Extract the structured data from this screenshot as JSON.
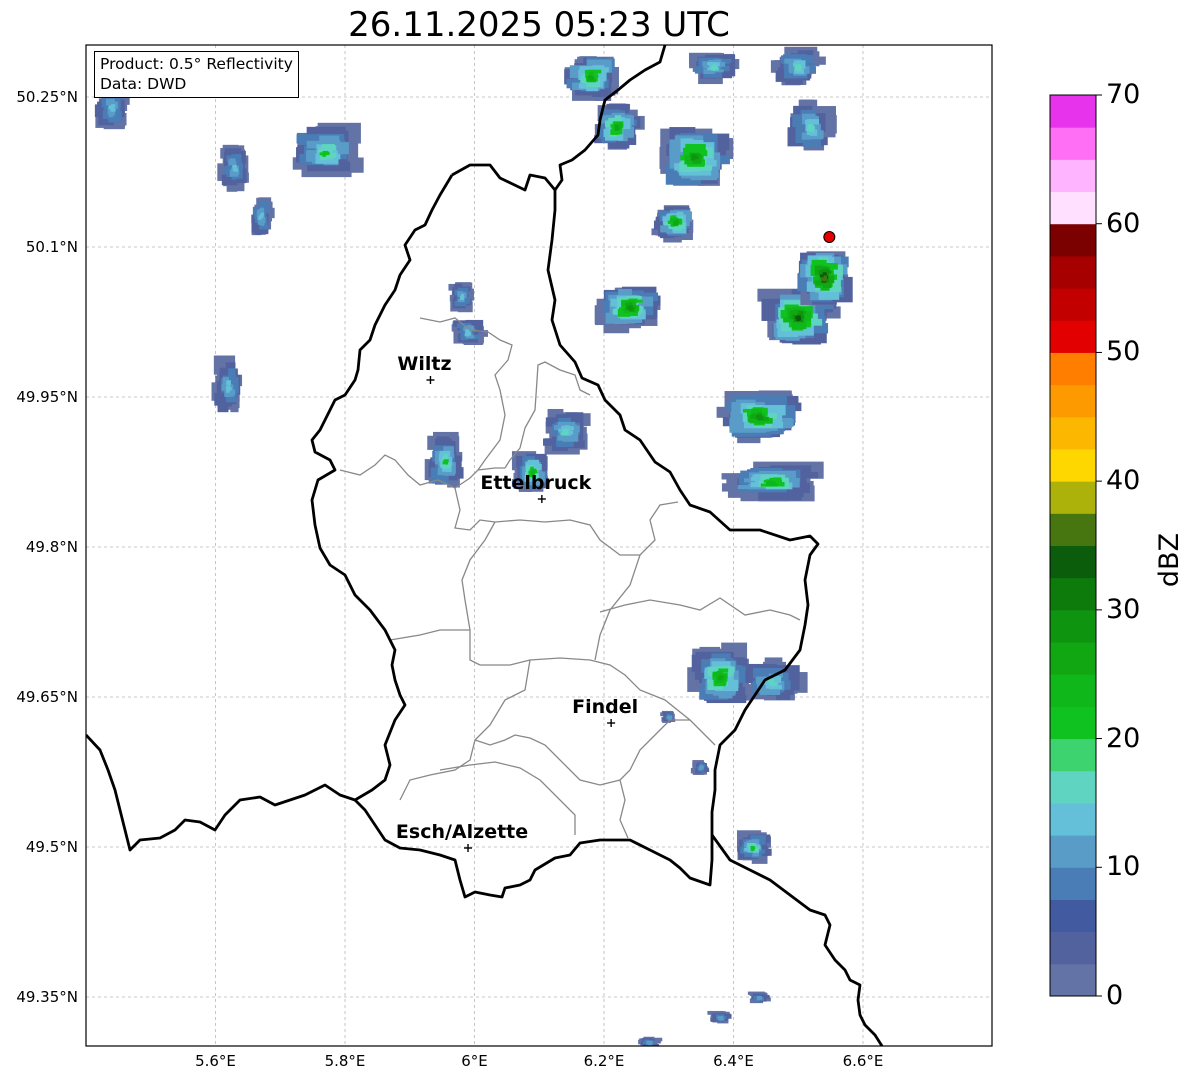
{
  "title": "26.11.2025 05:23 UTC",
  "info": {
    "product": "Product: 0.5° Reflectivity",
    "source": "Data: DWD"
  },
  "colorbar": {
    "label": "dBZ",
    "min": 0,
    "max": 70,
    "ticks": [
      "0",
      "10",
      "20",
      "30",
      "40",
      "50",
      "60",
      "70"
    ],
    "colors": [
      "#6373a5",
      "#52629f",
      "#425aa0",
      "#4a7db5",
      "#5a9cc8",
      "#64c0d9",
      "#5fd5c1",
      "#3dd36f",
      "#10c21f",
      "#0fb71a",
      "#10a712",
      "#0f9410",
      "#0c7b0c",
      "#0b5d0b",
      "#477611",
      "#adb20b",
      "#fed600",
      "#fcb700",
      "#fd9a00",
      "#ff7e00",
      "#e20000",
      "#c20000",
      "#a60000",
      "#7b0000",
      "#ffe0ff",
      "#ffb4ff",
      "#ff6ff6",
      "#e833ed"
    ]
  },
  "map": {
    "lon_range": [
      5.4,
      6.8
    ],
    "lat_range": [
      49.3,
      50.3
    ],
    "lat_ticks": [
      {
        "value": 50.25,
        "label": "50.25°N"
      },
      {
        "value": 50.1,
        "label": "50.1°N"
      },
      {
        "value": 49.95,
        "label": "49.95°N"
      },
      {
        "value": 49.8,
        "label": "49.8°N"
      },
      {
        "value": 49.65,
        "label": "49.65°N"
      },
      {
        "value": 49.5,
        "label": "49.5°N"
      },
      {
        "value": 49.35,
        "label": "49.35°N"
      }
    ],
    "lon_ticks": [
      {
        "value": 5.6,
        "label": "5.6°E"
      },
      {
        "value": 5.8,
        "label": "5.8°E"
      },
      {
        "value": 6.0,
        "label": "6°E"
      },
      {
        "value": 6.2,
        "label": "6.2°E"
      },
      {
        "value": 6.4,
        "label": "6.4°E"
      },
      {
        "value": 6.6,
        "label": "6.6°E"
      }
    ],
    "cities": [
      {
        "name": "Wiltz",
        "lon": 5.932,
        "lat": 49.967
      },
      {
        "name": "Ettelbruck",
        "lon": 6.104,
        "lat": 49.848
      },
      {
        "name": "Findel",
        "lon": 6.211,
        "lat": 49.624
      },
      {
        "name": "Esch/Alzette",
        "lon": 5.99,
        "lat": 49.499
      }
    ],
    "radar_site": {
      "lon": 6.548,
      "lat": 50.11,
      "color": "#e60000"
    },
    "radar_cells": [
      {
        "lon": 5.44,
        "lat": 50.24,
        "rx": 0.03,
        "ry": 0.03,
        "core": 4
      },
      {
        "lon": 5.63,
        "lat": 50.18,
        "rx": 0.025,
        "ry": 0.03,
        "core": 4
      },
      {
        "lon": 5.67,
        "lat": 50.13,
        "rx": 0.02,
        "ry": 0.03,
        "core": 4
      },
      {
        "lon": 5.77,
        "lat": 50.195,
        "rx": 0.06,
        "ry": 0.035,
        "core": 6
      },
      {
        "lon": 5.62,
        "lat": 49.96,
        "rx": 0.025,
        "ry": 0.04,
        "core": 4
      },
      {
        "lon": 5.98,
        "lat": 50.05,
        "rx": 0.02,
        "ry": 0.02,
        "core": 4
      },
      {
        "lon": 5.99,
        "lat": 50.015,
        "rx": 0.028,
        "ry": 0.02,
        "core": 4
      },
      {
        "lon": 5.955,
        "lat": 49.885,
        "rx": 0.03,
        "ry": 0.035,
        "core": 6
      },
      {
        "lon": 6.09,
        "lat": 49.875,
        "rx": 0.03,
        "ry": 0.028,
        "core": 7
      },
      {
        "lon": 6.14,
        "lat": 49.915,
        "rx": 0.04,
        "ry": 0.028,
        "core": 5
      },
      {
        "lon": 6.18,
        "lat": 50.27,
        "rx": 0.045,
        "ry": 0.03,
        "core": 8
      },
      {
        "lon": 6.22,
        "lat": 50.22,
        "rx": 0.04,
        "ry": 0.03,
        "core": 8
      },
      {
        "lon": 6.34,
        "lat": 50.19,
        "rx": 0.06,
        "ry": 0.04,
        "core": 9
      },
      {
        "lon": 6.31,
        "lat": 50.125,
        "rx": 0.035,
        "ry": 0.025,
        "core": 8
      },
      {
        "lon": 6.37,
        "lat": 50.28,
        "rx": 0.04,
        "ry": 0.02,
        "core": 5
      },
      {
        "lon": 6.5,
        "lat": 50.28,
        "rx": 0.04,
        "ry": 0.025,
        "core": 5
      },
      {
        "lon": 6.52,
        "lat": 50.22,
        "rx": 0.04,
        "ry": 0.035,
        "core": 5
      },
      {
        "lon": 6.24,
        "lat": 50.04,
        "rx": 0.05,
        "ry": 0.03,
        "core": 9
      },
      {
        "lon": 6.5,
        "lat": 50.03,
        "rx": 0.06,
        "ry": 0.04,
        "core": 10
      },
      {
        "lon": 6.54,
        "lat": 50.07,
        "rx": 0.045,
        "ry": 0.04,
        "core": 11
      },
      {
        "lon": 6.44,
        "lat": 49.93,
        "rx": 0.07,
        "ry": 0.035,
        "core": 9
      },
      {
        "lon": 6.46,
        "lat": 49.865,
        "rx": 0.08,
        "ry": 0.025,
        "core": 7
      },
      {
        "lon": 6.38,
        "lat": 49.67,
        "rx": 0.05,
        "ry": 0.04,
        "core": 8
      },
      {
        "lon": 6.46,
        "lat": 49.665,
        "rx": 0.05,
        "ry": 0.03,
        "core": 5
      },
      {
        "lon": 6.43,
        "lat": 49.5,
        "rx": 0.03,
        "ry": 0.02,
        "core": 6
      },
      {
        "lon": 6.35,
        "lat": 49.58,
        "rx": 0.015,
        "ry": 0.01,
        "core": 3
      },
      {
        "lon": 6.3,
        "lat": 49.63,
        "rx": 0.012,
        "ry": 0.008,
        "core": 3
      },
      {
        "lon": 6.44,
        "lat": 49.35,
        "rx": 0.02,
        "ry": 0.007,
        "core": 3
      },
      {
        "lon": 6.38,
        "lat": 49.33,
        "rx": 0.02,
        "ry": 0.008,
        "core": 3
      },
      {
        "lon": 6.27,
        "lat": 49.305,
        "rx": 0.02,
        "ry": 0.008,
        "core": 3
      }
    ]
  }
}
